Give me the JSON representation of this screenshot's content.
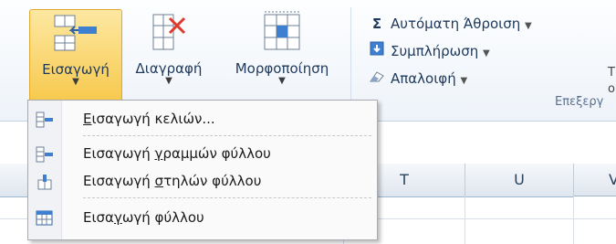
{
  "ribbon": {
    "insert": {
      "label": "Εισαγωγή",
      "icon": "insert-cells-icon"
    },
    "delete": {
      "label": "Διαγραφή",
      "icon": "delete-cells-icon"
    },
    "format": {
      "label": "Μορφοποίηση",
      "icon": "format-cells-icon"
    },
    "editing": {
      "autosum": {
        "label": "Αυτόματη Άθροιση",
        "icon": "sigma-icon"
      },
      "fill": {
        "label": "Συμπλήρωση",
        "icon": "fill-down-icon"
      },
      "clear": {
        "label": "Απαλοιφή",
        "icon": "eraser-icon"
      },
      "group_label": "Επεξεργ",
      "trunc_top": "Τ",
      "trunc_mid": "ο"
    }
  },
  "menu": {
    "items": [
      {
        "pre": "",
        "u": "Ε",
        "post": "ισαγωγή κελιών...",
        "icon": "insert-cells-icon"
      },
      {
        "pre": "Εισαγωγή ",
        "u": "γ",
        "post": "ραμμών φύλλου",
        "icon": "insert-rows-icon"
      },
      {
        "pre": "Εισαγωγή ",
        "u": "σ",
        "post": "τηλών φύλλου",
        "icon": "insert-columns-icon"
      },
      {
        "pre": "Εισα",
        "u": "γ",
        "post": "ωγή φύλλου",
        "icon": "insert-sheet-icon"
      }
    ]
  },
  "grid": {
    "columns": [
      "T",
      "U",
      "V"
    ]
  },
  "colors": {
    "highlight": "#f7c94d",
    "ribbon_text": "#1e395b"
  }
}
